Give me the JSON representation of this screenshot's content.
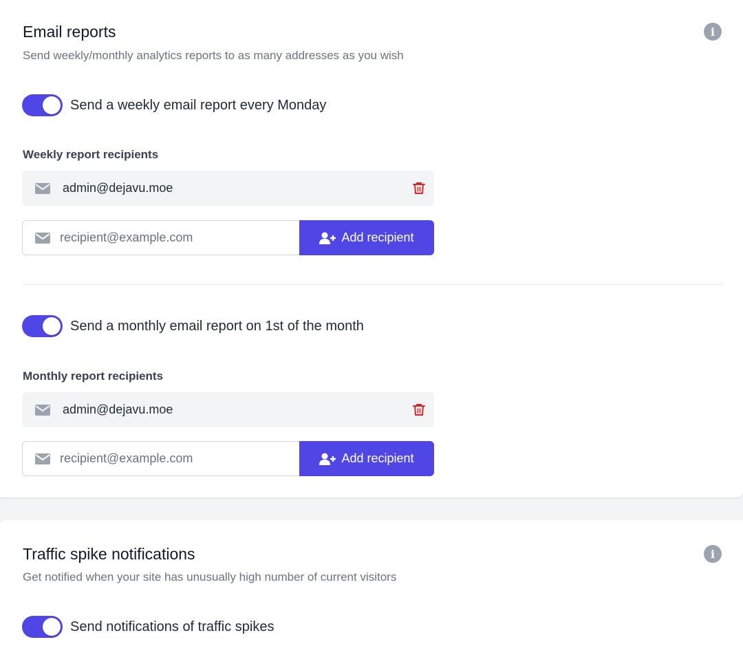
{
  "email_reports": {
    "title": "Email reports",
    "subtitle": "Send weekly/monthly analytics reports to as many addresses as you wish",
    "info_icon": "info-icon",
    "weekly": {
      "toggle_label": "Send a weekly email report every Monday",
      "enabled": true,
      "recipients_label": "Weekly report recipients",
      "recipients": [
        "admin@dejavu.moe"
      ],
      "input_placeholder": "recipient@example.com",
      "add_button_label": "Add recipient"
    },
    "monthly": {
      "toggle_label": "Send a monthly email report on 1st of the month",
      "enabled": true,
      "recipients_label": "Monthly report recipients",
      "recipients": [
        "admin@dejavu.moe"
      ],
      "input_placeholder": "recipient@example.com",
      "add_button_label": "Add recipient"
    }
  },
  "traffic_spikes": {
    "title": "Traffic spike notifications",
    "subtitle": "Get notified when your site has unusually high number of current visitors",
    "toggle_label": "Send notifications of traffic spikes",
    "enabled": true
  },
  "colors": {
    "accent": "#4f46e5",
    "delete": "#dc2626",
    "muted_text": "#6b7280",
    "icon_gray": "#9ca3af"
  }
}
